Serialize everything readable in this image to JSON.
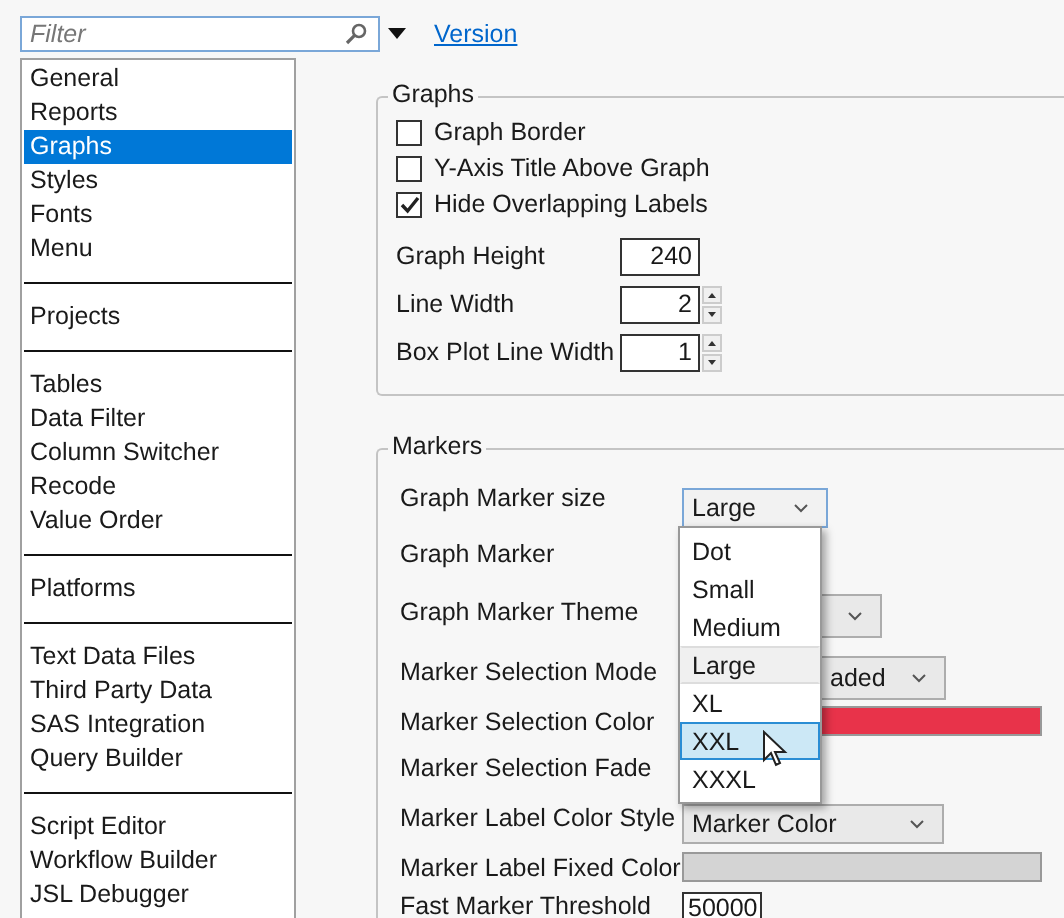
{
  "filter": {
    "placeholder": "Filter"
  },
  "version_link": "Version",
  "sidebar": {
    "groups": [
      {
        "items": [
          {
            "label": "General",
            "selected": false
          },
          {
            "label": "Reports",
            "selected": false
          },
          {
            "label": "Graphs",
            "selected": true
          },
          {
            "label": "Styles",
            "selected": false
          },
          {
            "label": "Fonts",
            "selected": false
          },
          {
            "label": "Menu",
            "selected": false
          }
        ]
      },
      {
        "items": [
          {
            "label": "Projects",
            "selected": false
          }
        ]
      },
      {
        "items": [
          {
            "label": "Tables",
            "selected": false
          },
          {
            "label": "Data Filter",
            "selected": false
          },
          {
            "label": "Column Switcher",
            "selected": false
          },
          {
            "label": "Recode",
            "selected": false
          },
          {
            "label": "Value Order",
            "selected": false
          }
        ]
      },
      {
        "items": [
          {
            "label": "Platforms",
            "selected": false
          }
        ]
      },
      {
        "items": [
          {
            "label": "Text Data Files",
            "selected": false
          },
          {
            "label": "Third Party Data",
            "selected": false
          },
          {
            "label": "SAS Integration",
            "selected": false
          },
          {
            "label": "Query Builder",
            "selected": false
          }
        ]
      },
      {
        "items": [
          {
            "label": "Script Editor",
            "selected": false
          },
          {
            "label": "Workflow Builder",
            "selected": false
          },
          {
            "label": "JSL Debugger",
            "selected": false
          }
        ]
      }
    ]
  },
  "graphs": {
    "title": "Graphs",
    "checkboxes": [
      {
        "label": "Graph Border",
        "checked": false
      },
      {
        "label": "Y-Axis Title Above Graph",
        "checked": false
      },
      {
        "label": "Hide Overlapping Labels",
        "checked": true
      }
    ],
    "fields": [
      {
        "label": "Graph Height",
        "value": "240",
        "kind": "number"
      },
      {
        "label": "Line Width",
        "value": "2",
        "kind": "spinner"
      },
      {
        "label": "Box Plot Line Width",
        "value": "1",
        "kind": "spinner"
      }
    ]
  },
  "markers": {
    "title": "Markers",
    "rows": [
      {
        "label": "Graph Marker size",
        "kind": "dropdown",
        "value": "Large",
        "expanded": true
      },
      {
        "label": "Graph Marker",
        "kind": "covered"
      },
      {
        "label": "Graph Marker Theme",
        "kind": "partial_dropdown"
      },
      {
        "label": "Marker Selection Mode",
        "kind": "partial_dropdown",
        "value": "aded"
      },
      {
        "label": "Marker Selection Color",
        "kind": "color_bar",
        "color": "#e8334a"
      },
      {
        "label": "Marker Selection Fade",
        "kind": "covered"
      },
      {
        "label": "Marker Label Color Style",
        "kind": "dropdown",
        "value": "Marker Color",
        "expanded": false
      },
      {
        "label": "Marker Label Fixed Color",
        "kind": "color_bar",
        "color": "#d4d4d4"
      },
      {
        "label": "Fast Marker Threshold",
        "kind": "field",
        "value": "50000"
      }
    ],
    "popup": [
      {
        "label": "Dot",
        "selected": false,
        "current": false
      },
      {
        "label": "Small",
        "selected": false,
        "current": false
      },
      {
        "label": "Medium",
        "selected": false,
        "current": false
      },
      {
        "label": "Large",
        "selected": false,
        "current": true
      },
      {
        "label": "XL",
        "selected": false,
        "current": false
      },
      {
        "label": "XXL",
        "selected": true,
        "current": false
      },
      {
        "label": "XXXL",
        "selected": false,
        "current": false
      }
    ]
  }
}
